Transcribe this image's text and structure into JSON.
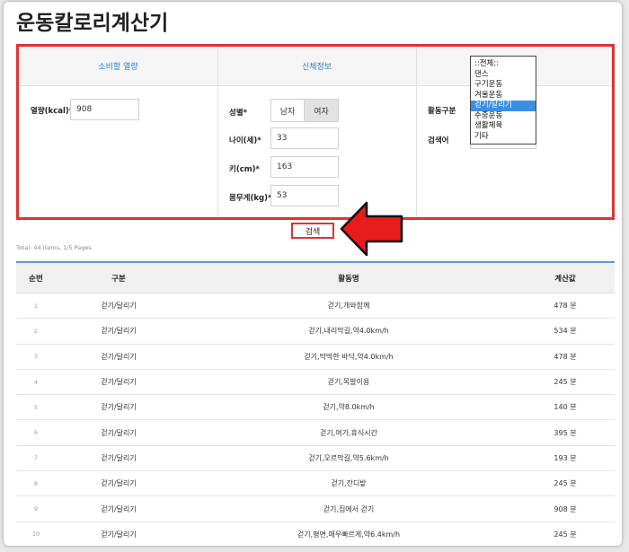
{
  "page": {
    "title": "운동칼로리계산기"
  },
  "sections": [
    {
      "header": "소비할 열량"
    },
    {
      "header": "신체정보"
    },
    {
      "header": ""
    }
  ],
  "calories": {
    "label": "열량(kcal)*",
    "value": "908"
  },
  "body": {
    "gender_label": "성별*",
    "male": "남자",
    "female": "여자",
    "age_label": "나이(세)*",
    "age_value": "33",
    "height_label": "키(cm)*",
    "height_value": "163",
    "weight_label": "몸무게(kg)*",
    "weight_value": "53"
  },
  "activity": {
    "category_label": "활동구분",
    "search_label": "검색어",
    "options": [
      "::전체::",
      "댄스",
      "구기운동",
      "겨울운동",
      "걷기/달리기",
      "수중운동",
      "생활체육",
      "기타"
    ],
    "selected": "걷기/달리기"
  },
  "search_button": "검색",
  "total_text": "Total: 44 Items, 1/5 Pages",
  "table": {
    "headers": [
      "순번",
      "구분",
      "활동명",
      "계산값"
    ],
    "rows": [
      [
        "1",
        "걷기/달리기",
        "걷기,개와함께",
        "478 분"
      ],
      [
        "2",
        "걷기/달리기",
        "걷기,내리막길,약4.0km/h",
        "534 분"
      ],
      [
        "3",
        "걷기/달리기",
        "걷기,딱딱한 바닥,약4.0km/h",
        "478 분"
      ],
      [
        "4",
        "걷기/달리기",
        "걷기,목발이용",
        "245 분"
      ],
      [
        "5",
        "걷기/달리기",
        "걷기,약8.0km/h",
        "140 분"
      ],
      [
        "6",
        "걷기/달리기",
        "걷기,여가,휴식시간",
        "395 분"
      ],
      [
        "7",
        "걷기/달리기",
        "걷기,오르막길,약5.6km/h",
        "193 분"
      ],
      [
        "8",
        "걷기/달리기",
        "걷기,잔디밭",
        "245 분"
      ],
      [
        "9",
        "걷기/달리기",
        "걷기,집에서 걷기",
        "908 분"
      ],
      [
        "10",
        "걷기/달리기",
        "걷기,평면,매우빠르게,약6.4km/h",
        "245 분"
      ]
    ]
  },
  "colors": {
    "highlight_border": "#e53030",
    "accent_blue": "#2a7fc1",
    "selected_option": "#3a8ee6"
  }
}
